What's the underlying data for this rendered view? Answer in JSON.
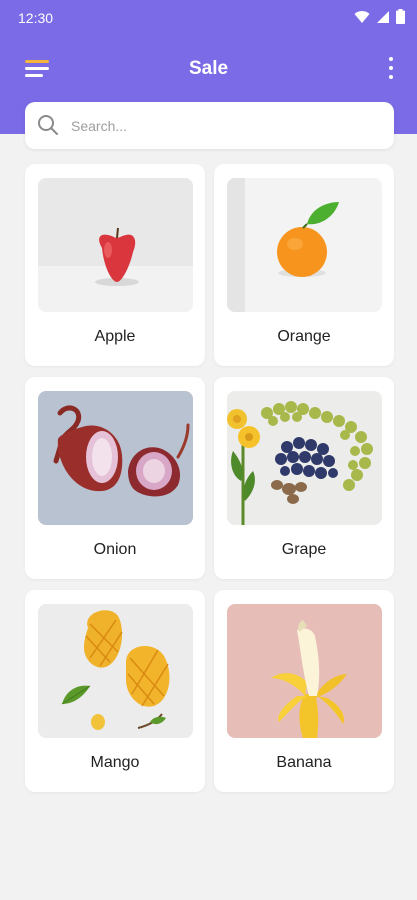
{
  "status_bar": {
    "time": "12:30"
  },
  "app_bar": {
    "title": "Sale",
    "menu_icon": "hamburger-menu-icon",
    "more_icon": "more-vertical-icon"
  },
  "search": {
    "placeholder": "Search..."
  },
  "colors": {
    "primary": "#7b6be6",
    "menu_accent": "#f5b43c",
    "background": "#f2f2f3"
  },
  "products": [
    {
      "name": "Apple",
      "image": "apple-image"
    },
    {
      "name": "Orange",
      "image": "orange-image"
    },
    {
      "name": "Onion",
      "image": "onion-image"
    },
    {
      "name": "Grape",
      "image": "grape-image"
    },
    {
      "name": "Mango",
      "image": "mango-image"
    },
    {
      "name": "Banana",
      "image": "banana-image"
    }
  ]
}
